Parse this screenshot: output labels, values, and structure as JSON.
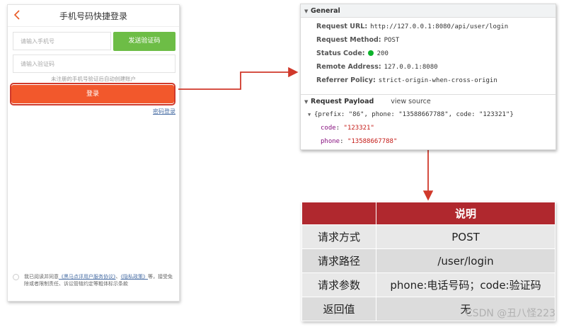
{
  "phone": {
    "back_icon": "chevron-left-icon",
    "title": "手机号码快捷登录",
    "phone_placeholder": "请输入手机号",
    "send_code_label": "发送验证码",
    "code_placeholder": "请输入验证码",
    "hint": "未注册的手机号验证后自动创建账户",
    "login_label": "登录",
    "password_login_label": "密码登录",
    "agreement": {
      "prefix": "我已阅读并同意",
      "link1": "《黑马点评用户服务协议》",
      "sep": "、",
      "link2": "《隐私政策》",
      "suffix": "等，接受免除或者限制责任、诉讼管辖约定等粗体标示条款"
    }
  },
  "devtools": {
    "general_title": "General",
    "general": [
      {
        "key": "Request URL:",
        "value": "http://127.0.0.1:8080/api/user/login"
      },
      {
        "key": "Request Method:",
        "value": "POST"
      },
      {
        "key": "Status Code:",
        "value": "200"
      },
      {
        "key": "Remote Address:",
        "value": "127.0.0.1:8080"
      },
      {
        "key": "Referrer Policy:",
        "value": "strict-origin-when-cross-origin"
      }
    ],
    "payload_title": "Request Payload",
    "view_source": "view source",
    "payload_summary": "{prefix: \"86\", phone: \"13588667788\", code: \"123321\"}",
    "payload_fields": [
      {
        "key": "code",
        "value": "\"123321\""
      },
      {
        "key": "phone",
        "value": "\"13588667788\""
      }
    ],
    "status_color": "#0db32b"
  },
  "table": {
    "header": [
      "",
      "说明"
    ],
    "rows": [
      [
        "请求方式",
        "POST"
      ],
      [
        "请求路径",
        "/user/login"
      ],
      [
        "请求参数",
        "phone:电话号码；code:验证码"
      ],
      [
        "返回值",
        "无"
      ]
    ],
    "header_color": "#b0282e"
  },
  "watermark": "CSDN @丑八怪223",
  "accent_colors": {
    "login_button": "#f2582c",
    "send_code_button": "#6dbd46",
    "arrow": "#d0392b"
  }
}
